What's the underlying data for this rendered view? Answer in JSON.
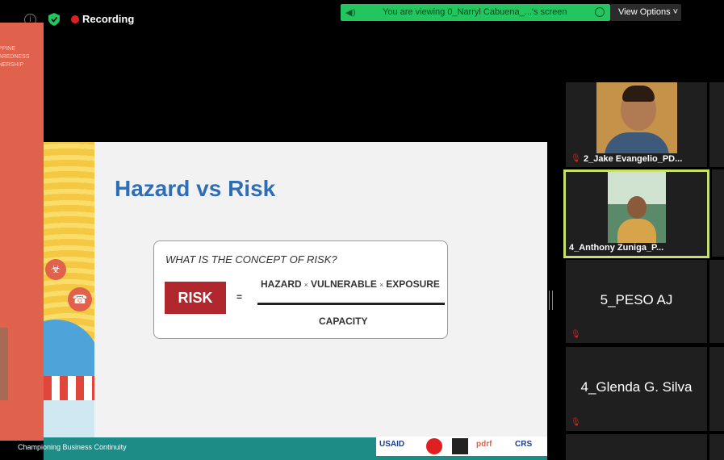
{
  "status": {
    "recording_label": "Recording"
  },
  "banner": {
    "text": "You are viewing 0_Narryl Cabuena_...'s screen",
    "view_options_label": "View Options ˅",
    "color": "#22c55e"
  },
  "left_panel": {
    "text_lines": [
      "PPINE",
      "AREDNESS",
      "NERSHIP"
    ],
    "color": "#e0624c"
  },
  "slide": {
    "title": "Hazard vs Risk",
    "question": "WHAT IS THE CONCEPT OF RISK?",
    "risk_label": "RISK",
    "equals": "=",
    "numerator": [
      "HAZARD",
      "VULNERABLE",
      "EXPOSURE"
    ],
    "separator": "×",
    "denominator": "CAPACITY",
    "footer_text": "Championing Business Continuity",
    "logos": [
      "USAID",
      "pdrf",
      "CRS"
    ],
    "title_color": "#2f6db5",
    "risk_color": "#b0272e",
    "footer_color": "#1d8c87"
  },
  "participants": [
    {
      "name": "2_Jake Evangelio_PD...",
      "muted": true,
      "video": true
    },
    {
      "name": "4_Anthony Zuniga_P...",
      "muted": false,
      "video": true,
      "active_speaker": true
    },
    {
      "name": "5_PESO AJ",
      "muted": true,
      "video": false
    },
    {
      "name": "4_Glenda G. Silva",
      "muted": true,
      "video": false
    }
  ],
  "active_speaker_color": "#c8e06a"
}
